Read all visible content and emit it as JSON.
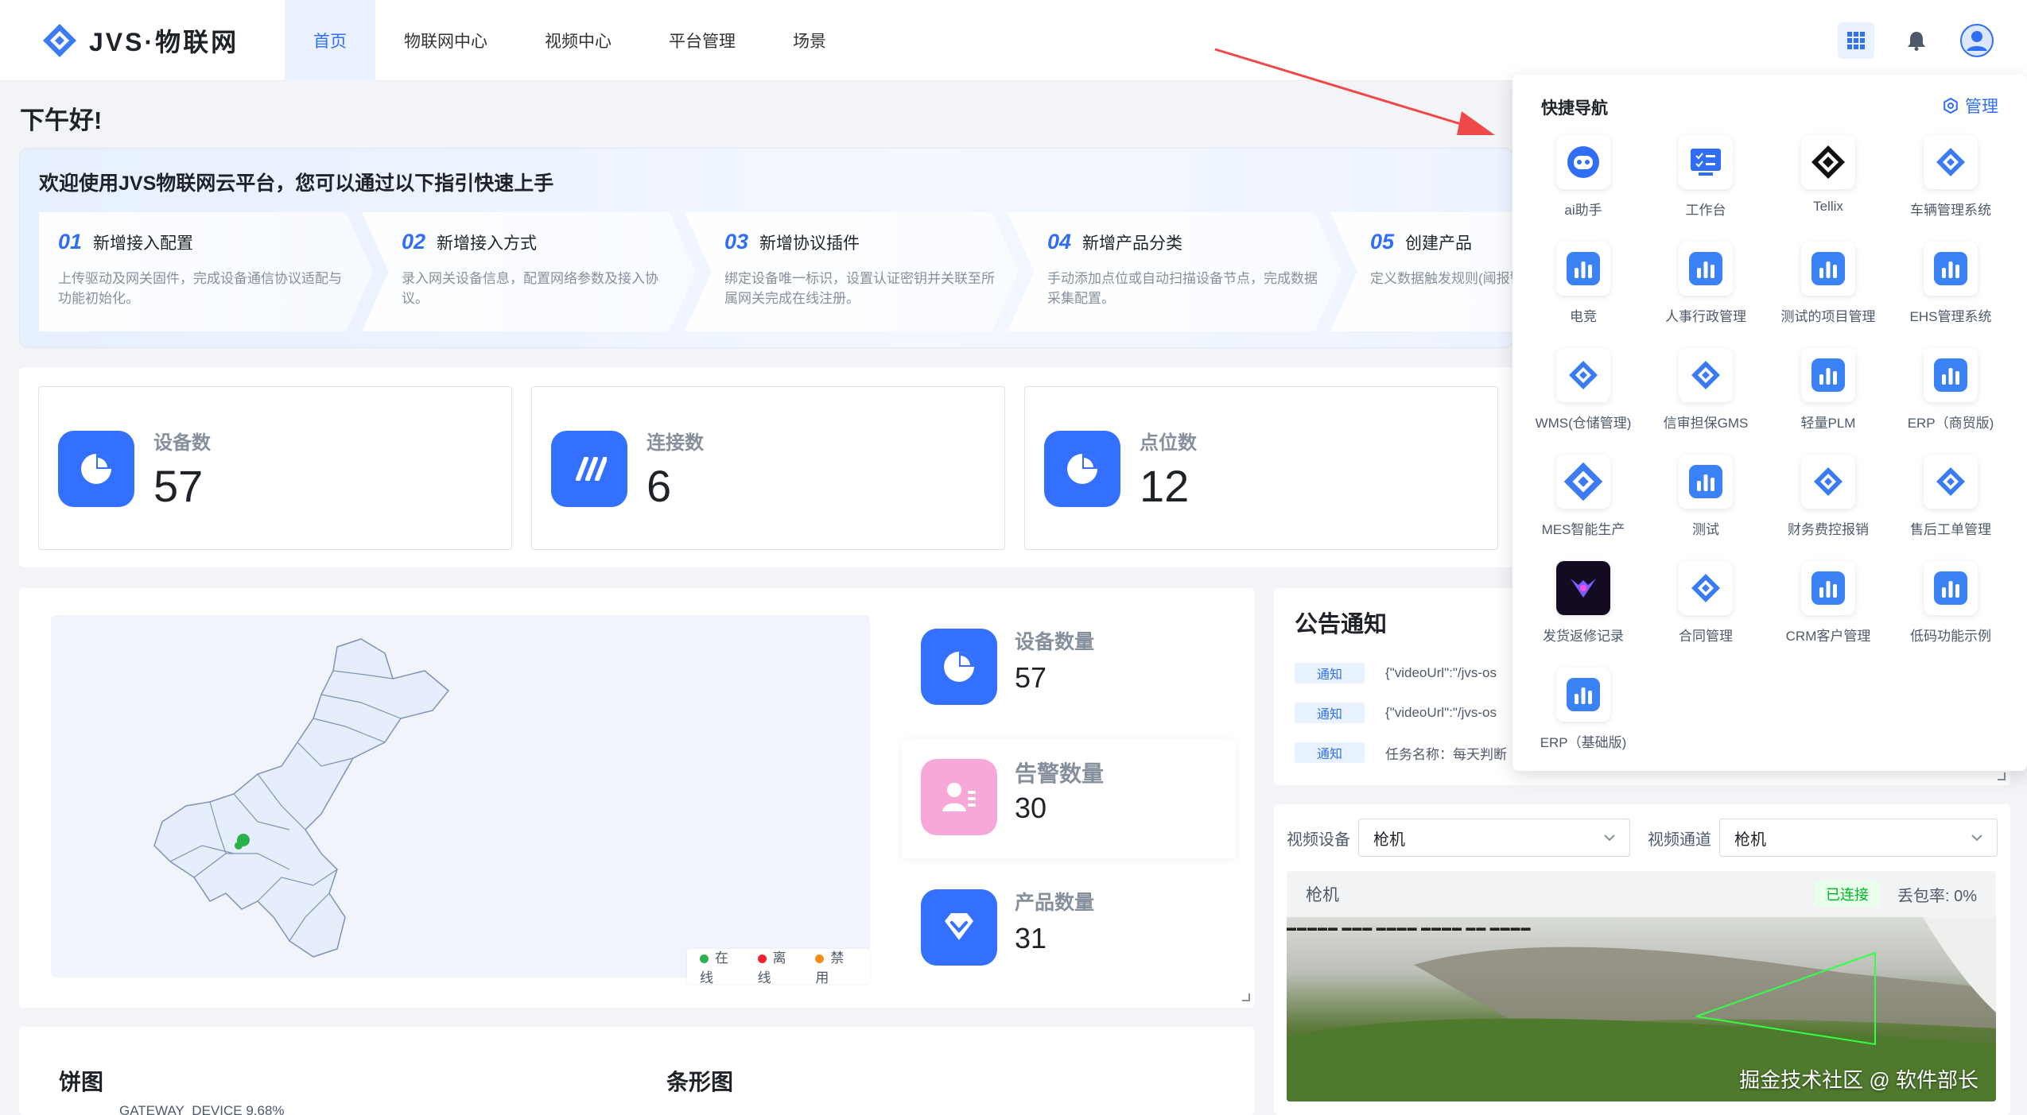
{
  "app": {
    "logo_text": "JVS·物联网"
  },
  "nav": [
    {
      "label": "首页",
      "active": true
    },
    {
      "label": "物联网中心"
    },
    {
      "label": "视频中心"
    },
    {
      "label": "平台管理"
    },
    {
      "label": "场景"
    }
  ],
  "top_icons": [
    "apps-grid-icon",
    "bell-icon",
    "user-avatar-icon"
  ],
  "greeting": "下午好!",
  "guide": {
    "title": "欢迎使用JVS物联网云平台，您可以通过以下指引快速上手",
    "steps": [
      {
        "num": "01",
        "name": "新增接入配置",
        "desc": "上传驱动及网关固件，完成设备通信协议适配与功能初始化。"
      },
      {
        "num": "02",
        "name": "新增接入方式",
        "desc": "录入网关设备信息，配置网络参数及接入协议。"
      },
      {
        "num": "03",
        "name": "新增协议插件",
        "desc": "绑定设备唯一标识，设置认证密钥并关联至所属网关完成在线注册。"
      },
      {
        "num": "04",
        "name": "新增产品分类",
        "desc": "手动添加点位或自动扫描设备节点，完成数据采集配置。"
      },
      {
        "num": "05",
        "name": "创建产品",
        "desc": "定义数据触发规则(阈报警通知方式及自动"
      }
    ]
  },
  "stats": [
    {
      "label": "设备数",
      "value": "57",
      "icon": "pie-chart-icon"
    },
    {
      "label": "连接数",
      "value": "6",
      "icon": "connection-slash-icon"
    },
    {
      "label": "点位数",
      "value": "12",
      "icon": "pie-chart-icon"
    }
  ],
  "map": {
    "legend": [
      {
        "label": "在线",
        "color": "#2bb24c"
      },
      {
        "label": "离线",
        "color": "#f5222d"
      },
      {
        "label": "禁用",
        "color": "#fa8c16"
      }
    ]
  },
  "map_stats": [
    {
      "label": "设备数量",
      "value": "57",
      "icon": "pie-chart-icon",
      "color": "#3370ff"
    },
    {
      "label": "告警数量",
      "value": "30",
      "icon": "user-alert-icon",
      "color": "#f7a8d8"
    },
    {
      "label": "产品数量",
      "value": "31",
      "icon": "diamond-icon",
      "color": "#3370ff"
    }
  ],
  "notice": {
    "title": "公告通知",
    "items": [
      {
        "tag": "通知",
        "text": "{\"videoUrl\":\"/jvs-os"
      },
      {
        "tag": "通知",
        "text": "{\"videoUrl\":\"/jvs-os"
      },
      {
        "tag": "通知",
        "text": "任务名称：每天判断"
      }
    ]
  },
  "video": {
    "device_label": "视频设备",
    "device_value": "枪机",
    "channel_label": "视频通道",
    "channel_value": "枪机",
    "camera_name": "枪机",
    "status": "已连接",
    "loss": "丢包率: 0%",
    "watermark": "掘金技术社区 @ 软件部长"
  },
  "charts": {
    "pie_title": "饼图",
    "bar_title": "条形图",
    "pie_label": "GATEWAY_DEVICE 9.68%"
  },
  "quick_nav": {
    "title": "快捷导航",
    "manage": "管理",
    "items": [
      {
        "label": "ai助手",
        "icon": "robot-icon"
      },
      {
        "label": "工作台",
        "icon": "workbench-icon"
      },
      {
        "label": "Tellix",
        "icon": "tellix-logo-icon"
      },
      {
        "label": "车辆管理系统",
        "icon": "jvs-logo-icon"
      },
      {
        "label": "电竞",
        "icon": "bar-chart-icon"
      },
      {
        "label": "人事行政管理",
        "icon": "bar-chart-icon"
      },
      {
        "label": "测试的项目管理",
        "icon": "bar-chart-icon"
      },
      {
        "label": "EHS管理系统",
        "icon": "bar-chart-icon"
      },
      {
        "label": "WMS(仓储管理)",
        "icon": "jvs-logo-icon"
      },
      {
        "label": "信审担保GMS",
        "icon": "jvs-logo-icon"
      },
      {
        "label": "轻量PLM",
        "icon": "bar-chart-icon"
      },
      {
        "label": "ERP（商贸版)",
        "icon": "bar-chart-icon"
      },
      {
        "label": "MES智能生产",
        "icon": "jvs-logo-large-icon"
      },
      {
        "label": "测试",
        "icon": "bar-chart-icon"
      },
      {
        "label": "财务费控报销",
        "icon": "jvs-logo-icon"
      },
      {
        "label": "售后工单管理",
        "icon": "jvs-logo-icon"
      },
      {
        "label": "发货返修记录",
        "icon": "dark-emblem-icon"
      },
      {
        "label": "合同管理",
        "icon": "jvs-logo-icon"
      },
      {
        "label": "CRM客户管理",
        "icon": "bar-chart-icon"
      },
      {
        "label": "低码功能示例",
        "icon": "bar-chart-icon"
      },
      {
        "label": "ERP（基础版)",
        "icon": "bar-chart-icon"
      }
    ]
  }
}
